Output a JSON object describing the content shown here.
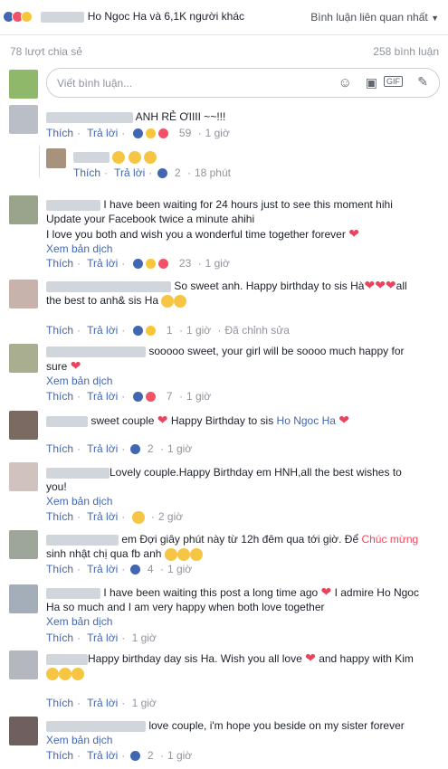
{
  "header": {
    "reactors_text": "Ho Ngoc Ha và 6,1K người khác",
    "sort_label": "Bình luận liên quan nhất"
  },
  "stats": {
    "shares": "78 lượt chia sẻ",
    "comments": "258 bình luận"
  },
  "composer": {
    "placeholder": "Viết bình luận..."
  },
  "labels": {
    "like": "Thích",
    "reply": "Trả lời",
    "translate": "Xem bản dịch",
    "edited": "Đã chỉnh sửa",
    "dot": "·"
  },
  "comments": [
    {
      "text": "ANH RẺ ƠIIII ~~!!!",
      "count": "59",
      "time": "1 giờ"
    },
    {
      "reply_count": "2",
      "reply_time": "18 phút"
    },
    {
      "text1": "I have been waiting for 24 hours just to see this moment hihi",
      "text2": "Update your Facebook twice a minute ahihi",
      "text3": "I love you both and wish you a wonderful time together forever",
      "count": "23",
      "time": "1 giờ"
    },
    {
      "text1": "So sweet anh. Happy birthday to sis Hà",
      "text1b": "all",
      "text2": "the best to anh& sis Ha",
      "count": "1",
      "time": "1 giờ"
    },
    {
      "text1": "sooooo sweet, your girl will be soooo much happy for",
      "text2": "sure",
      "count": "7",
      "time": "1 giờ"
    },
    {
      "text1": "sweet couple",
      "text2": "Happy Birthday to sis",
      "mention": "Ho Ngoc Ha",
      "count": "2",
      "time": "1 giờ"
    },
    {
      "text1": "Lovely couple.Happy Birthday em HNH,all the best wishes to",
      "text2": "you!",
      "count": "",
      "time": "2 giờ"
    },
    {
      "text1": "em Đợi giây phút này từ 12h đêm qua tới giờ. Để",
      "highlight": "Chúc mừng",
      "text2": "sinh nhật chị qua fb anh",
      "count": "4",
      "time": "1 giờ"
    },
    {
      "text1": "I have been waiting this post a long time ago",
      "text1b": "I admire Ho Ngoc",
      "text2": "Ha so much and I am very happy when both love together",
      "time": "1 giờ"
    },
    {
      "text1": "Happy birthday day sis Ha. Wish you all love",
      "text1b": "and happy with Kim",
      "time": "1 giờ"
    },
    {
      "text1": "love couple, i'm hope you beside on my sister forever",
      "count": "2",
      "time": "1 giờ"
    }
  ],
  "colors": {
    "link": "#4267b2",
    "meta": "#90949c",
    "heart": "#e9435d",
    "accent": "#f7435d"
  }
}
